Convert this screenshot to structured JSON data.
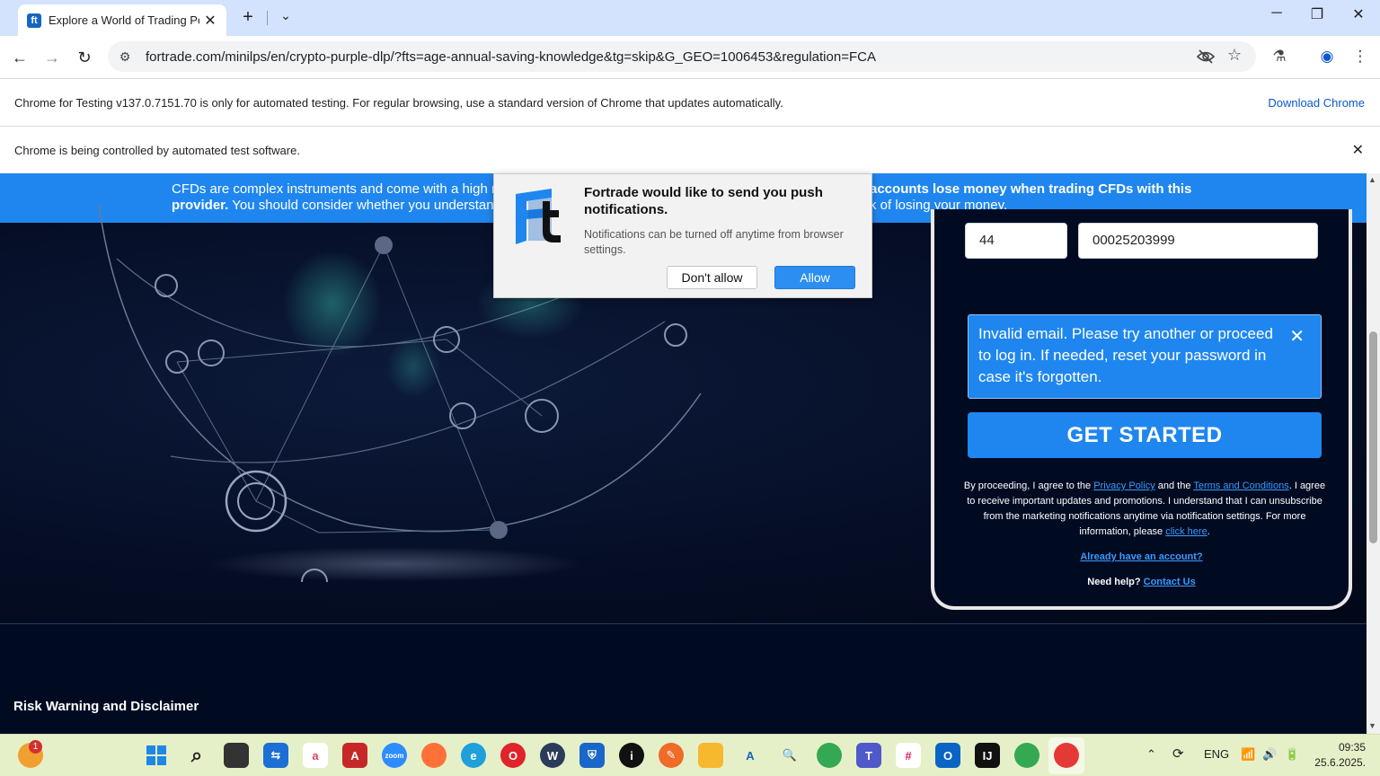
{
  "browser": {
    "tab_title": "Explore a World of Trading Possibilities",
    "url": "fortrade.com/minilps/en/crypto-purple-dlp/?fts=age-annual-saving-knowledge&tg=skip&G_GEO=1006453&regulation=FCA",
    "testing_notice": "Chrome for Testing v137.0.7151.70 is only for automated testing. For regular browsing, use a standard version of Chrome that updates automatically.",
    "download_link": "Download Chrome",
    "automation_notice": "Chrome is being controlled by automated test software."
  },
  "banner": {
    "left_text_1": "CFDs are complex instruments and come with a high ris",
    "left_text_2_bold": "provider.",
    "left_text_2": " You should consider whether you understand",
    "right_text_1_bold": "accounts lose money when trading CFDs with this",
    "right_text_2": "k of losing your money."
  },
  "form": {
    "phone_prefix": "44",
    "phone_number": "00025203999",
    "error_message": "Invalid email. Please try another or proceed to log in. If needed, reset your password in case it's forgotten.",
    "cta_label": "GET STARTED",
    "legal_1": "By proceeding, I agree to the ",
    "privacy_link": "Privacy Policy",
    "legal_and": " and the ",
    "terms_link": "Terms and Conditions",
    "legal_2": ". I agree to receive important updates and promotions. I understand that I can unsubscribe from the marketing notifications anytime via notification settings. For more information, please ",
    "click_here": "click here",
    "legal_end": ".",
    "already_account": "Already have an account?",
    "need_help": "Need help?",
    "contact_us": "Contact Us"
  },
  "footer": {
    "title": "Risk Warning and Disclaimer"
  },
  "notification": {
    "title": "Fortrade would like to send you push notifications.",
    "subtitle": "Notifications can be turned off anytime from browser settings.",
    "deny_label": "Don't allow",
    "allow_label": "Allow"
  },
  "taskbar": {
    "badge_count": "1",
    "language": "ENG",
    "time": "09:35",
    "date": "25.6.2025."
  }
}
